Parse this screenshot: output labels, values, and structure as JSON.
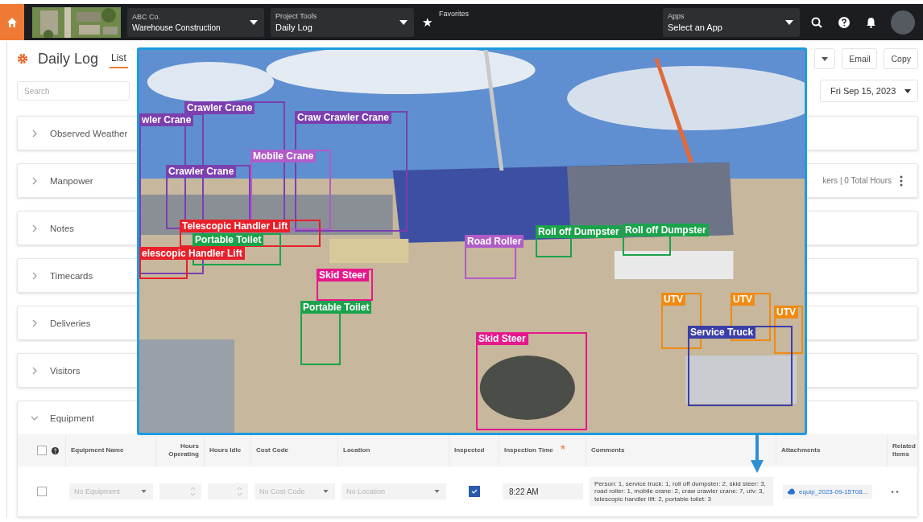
{
  "topbar": {
    "project": {
      "company": "ABC Co.",
      "name": "Warehouse Construction"
    },
    "tool": {
      "label": "Project Tools",
      "value": "Daily Log"
    },
    "favorites": {
      "icon": "★",
      "label": "Favorites"
    },
    "apps": {
      "label": "Apps",
      "value": "Select an App"
    }
  },
  "page": {
    "title": "Daily Log",
    "tabs": [
      {
        "label": "List",
        "selected": true
      }
    ],
    "actions": [
      "Email",
      "Copy"
    ]
  },
  "search": {
    "placeholder": "Search"
  },
  "date": "Fri Sep 15, 2023",
  "sections": [
    {
      "title": "Observed Weather",
      "expanded": false
    },
    {
      "title": "Manpower",
      "expanded": false,
      "summary": "kers | 0 Total Hours"
    },
    {
      "title": "Notes",
      "expanded": false
    },
    {
      "title": "Timecards",
      "expanded": false
    },
    {
      "title": "Deliveries",
      "expanded": false
    },
    {
      "title": "Visitors",
      "expanded": false
    },
    {
      "title": "Equipment",
      "expanded": true
    }
  ],
  "equipment": {
    "all_selected": false,
    "columns": [
      {
        "label": "Equipment Name"
      },
      {
        "label": "Hours Operating"
      },
      {
        "label": "Hours Idle"
      },
      {
        "label": "Cost Code"
      },
      {
        "label": "Location"
      },
      {
        "label": "Inspected"
      },
      {
        "label": "Inspection Time",
        "required_mark": "*"
      },
      {
        "label": "Comments"
      },
      {
        "label": "Attachments"
      },
      {
        "label": "Related Items"
      }
    ],
    "rows": [
      {
        "checked": false,
        "name_placeholder": "No Equipment",
        "cost_code_placeholder": "No Cost Code",
        "location_placeholder": "No Location",
        "inspected": true,
        "inspection_time": "8:22 AM",
        "comments": "Person: 1, service truck: 1, roll off dumpster: 2, skid steer: 3, road roller: 1, mobile crane: 2, craw crawler crane: 7, utv: 3, telescopic handler lift: 2, portable toilet: 3",
        "attachment": "equip_2023-09-15T08..."
      }
    ]
  },
  "photo": {
    "kind": "picture",
    "detections": [
      {
        "label": "wler Crane",
        "color": "#7b3fb0"
      },
      {
        "label": "Crawler Crane",
        "color": "#7b3fb0"
      },
      {
        "label": "Craw Crawler Crane",
        "color": "#7b3fb0"
      },
      {
        "label": "Mobile Crane",
        "color": "#b05cc8"
      },
      {
        "label": "Crawler Crane",
        "color": "#7b3fb0"
      },
      {
        "label": "Telescopic Handler Lift",
        "color": "#e8202a"
      },
      {
        "label": "Portable Toilet",
        "color": "#1aa34a"
      },
      {
        "label": "elescopic Handler Lift",
        "color": "#e8202a"
      },
      {
        "label": "Road Roller",
        "color": "#b05cc8"
      },
      {
        "label": "Roll off Dumpster",
        "color": "#1aa34a"
      },
      {
        "label": "Roll off Dumpster",
        "color": "#1aa34a"
      },
      {
        "label": "Skid Steer",
        "color": "#e6198a"
      },
      {
        "label": "Portable Toilet",
        "color": "#1aa34a"
      },
      {
        "label": "Skid Steer",
        "color": "#e6198a"
      },
      {
        "label": "UTV",
        "color": "#f08a12"
      },
      {
        "label": "UTV",
        "color": "#f08a12"
      },
      {
        "label": "UTV",
        "color": "#f08a12"
      },
      {
        "label": "Service Truck",
        "color": "#3a3fa8"
      }
    ]
  }
}
